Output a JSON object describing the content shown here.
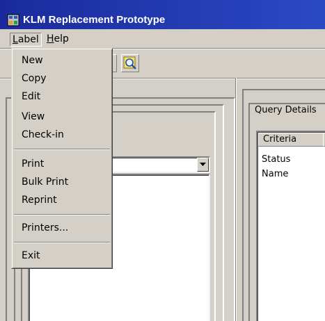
{
  "window": {
    "title": "KLM Replacement Prototype"
  },
  "menubar": {
    "items": [
      {
        "label": "Label",
        "mnemonic": "L",
        "rest": "abel"
      },
      {
        "label": "Help",
        "mnemonic": "H",
        "rest": "elp"
      }
    ]
  },
  "label_menu": {
    "items": [
      "New",
      "Copy",
      "Edit",
      "View",
      "Check-in",
      "Print",
      "Bulk Print",
      "Reprint",
      "Printers...",
      "Exit"
    ]
  },
  "query_panel": {
    "title": "Query Details",
    "column_header": "Criteria",
    "rows": [
      "Status",
      "Name"
    ]
  },
  "icons": {
    "app": "app-window-icon",
    "search": "magnifier-icon",
    "combo": "chevron-down-icon"
  }
}
